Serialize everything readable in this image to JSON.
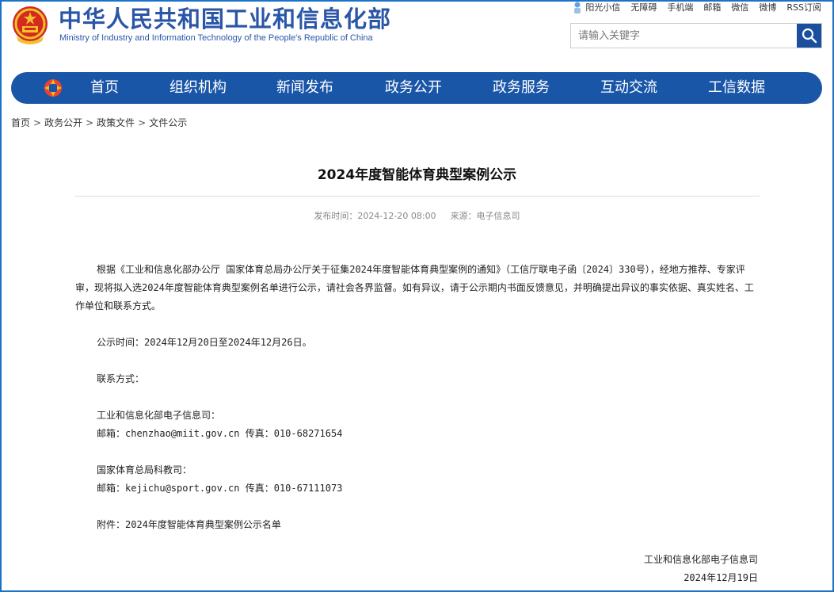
{
  "header": {
    "site_name_cn": "中华人民共和国工业和信息化部",
    "site_name_en": "Ministry of Industry and Information Technology of the People's Republic of China",
    "top_links": [
      "阳光小信",
      "无障碍",
      "手机端",
      "邮箱",
      "微信",
      "微博",
      "RSS订阅"
    ],
    "search_placeholder": "请输入关键字"
  },
  "nav": {
    "items": [
      "首页",
      "组织机构",
      "新闻发布",
      "政务公开",
      "政务服务",
      "互动交流",
      "工信数据"
    ]
  },
  "breadcrumb": [
    "首页",
    "政务公开",
    "政策文件",
    "文件公示"
  ],
  "article": {
    "title": "2024年度智能体育典型案例公示",
    "publish_time": "发布时间：2024-12-20 08:00",
    "source": "来源：电子信息司",
    "para1": "根据《工业和信息化部办公厅 国家体育总局办公厅关于征集2024年度智能体育典型案例的通知》（工信厅联电子函〔2024〕330号），经地方推荐、专家评审，现将拟入选2024年度智能体育典型案例名单进行公示，请社会各界监督。如有异议，请于公示期内书面反馈意见，并明确提出异议的事实依据、真实姓名、工作单位和联系方式。",
    "para2": "公示时间：2024年12月20日至2024年12月26日。",
    "contact_label": "联系方式：",
    "org1_name": "工业和信息化部电子信息司：",
    "org1_contact": "邮箱：chenzhao@miit.gov.cn  传真：010-68271654",
    "org2_name": "国家体育总局科教司：",
    "org2_contact": "邮箱：kejichu@sport.gov.cn  传真：010-67111073",
    "attachment": "附件：2024年度智能体育典型案例公示名单",
    "signature_org": "工业和信息化部电子信息司",
    "signature_date": "2024年12月19日"
  },
  "colors": {
    "brand_blue": "#1a56a8",
    "title_blue": "#2a56a8",
    "search_button": "#1a4fa0"
  }
}
